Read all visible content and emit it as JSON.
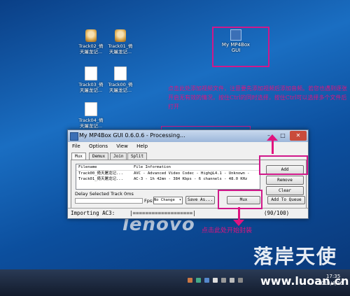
{
  "desktop": {
    "icons": [
      {
        "label_line1": "Track02_倚",
        "label_line2": "天屠龙记...",
        "kind": "avatar"
      },
      {
        "label_line1": "Track01_倚",
        "label_line2": "天屠龙记...",
        "kind": "avatar"
      },
      {
        "label_line1": "Track03_倚",
        "label_line2": "天屠龙记...",
        "kind": "doc"
      },
      {
        "label_line1": "Track00_倚",
        "label_line2": "天屠龙记...",
        "kind": "doc"
      },
      {
        "label_line1": "Track04_倚",
        "label_line2": "天屠龙记...",
        "kind": "doc"
      },
      {
        "label_line1": "My MP4Box",
        "label_line2": "GUI",
        "kind": "app"
      }
    ],
    "brand": "lenovo"
  },
  "annotations": {
    "top_note": "点击此处添加视频文件，注意要先添加视频后添加音频。若您也遇到逐张开启无有效的情况，按住Ctrl的同时选择，按住Ctrl可以选择多个文件后打开",
    "bottom_note": "点击此处开始封装"
  },
  "window": {
    "title": "My MP4Box GUI 0.6.0.6 - Processing...",
    "controls": {
      "minimize": "–",
      "maximize": "□",
      "close": "✕"
    },
    "menu": [
      "File",
      "Options",
      "View",
      "Help"
    ],
    "tabs": [
      "Mux",
      "Demux",
      "Join",
      "Split"
    ],
    "list": {
      "headers": [
        "Filename",
        "File Information"
      ],
      "rows": [
        {
          "file": "Track00_倚天屠龙记...",
          "info": "AVC - Advanced Video Codec - High@L4.1 - Unknown -"
        },
        {
          "file": "Track01_倚天屠龙记...",
          "info": "AC-3 - 1h 42mn - 384 Kbps - 6 channels - 48.0 KHz"
        }
      ]
    },
    "buttons": {
      "add": "Add",
      "remove": "Remove",
      "clear": "Clear",
      "save_as": "Save As...",
      "mux": "Mux",
      "add_to_queue": "Add To Queue"
    },
    "delay_label": "Delay Selected Track 0ms",
    "fps_label": "Fps:",
    "fps_value": "No Change",
    "status": {
      "left": "Importing AC3:",
      "bar": "|===================|",
      "right": "(90/100)"
    }
  },
  "taskbar": {
    "time": "17:35",
    "date": "2013/4/26"
  },
  "watermark": {
    "text_cn": "落岸天使",
    "url": "www.luoan.cn"
  },
  "colors": {
    "annotation": "#e0147f",
    "desktop": "#1a6ec2"
  }
}
